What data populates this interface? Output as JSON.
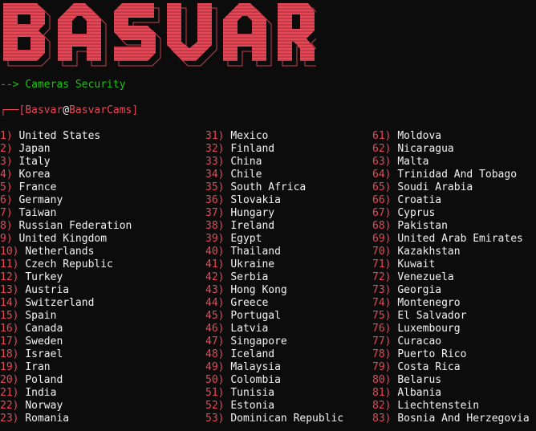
{
  "banner": {
    "text": "BASVAR",
    "color": "#e74856"
  },
  "subtitle": "--> Cameras Security",
  "prompt": {
    "prefix": "┌──[",
    "user": "Basvar",
    "at": "@",
    "host": "BasvarCams",
    "suffix": "]"
  },
  "colors": {
    "number": "#e74856",
    "text": "#f2f2f2",
    "accent": "#16c60c",
    "background": "#0c0c0c"
  },
  "countries": [
    {
      "num": "1)",
      "name": "United States"
    },
    {
      "num": "2)",
      "name": "Japan"
    },
    {
      "num": "3)",
      "name": "Italy"
    },
    {
      "num": "4)",
      "name": "Korea"
    },
    {
      "num": "5)",
      "name": "France"
    },
    {
      "num": "6)",
      "name": "Germany"
    },
    {
      "num": "7)",
      "name": "Taiwan"
    },
    {
      "num": "8)",
      "name": "Russian Federation"
    },
    {
      "num": "9)",
      "name": "United Kingdom"
    },
    {
      "num": "10)",
      "name": "Netherlands"
    },
    {
      "num": "11)",
      "name": "Czech Republic"
    },
    {
      "num": "12)",
      "name": "Turkey"
    },
    {
      "num": "13)",
      "name": "Austria"
    },
    {
      "num": "14)",
      "name": "Switzerland"
    },
    {
      "num": "15)",
      "name": "Spain"
    },
    {
      "num": "16)",
      "name": "Canada"
    },
    {
      "num": "17)",
      "name": "Sweden"
    },
    {
      "num": "18)",
      "name": "Israel"
    },
    {
      "num": "19)",
      "name": "Iran"
    },
    {
      "num": "20)",
      "name": "Poland"
    },
    {
      "num": "21)",
      "name": "India"
    },
    {
      "num": "22)",
      "name": "Norway"
    },
    {
      "num": "23)",
      "name": "Romania"
    },
    {
      "num": "31)",
      "name": "Mexico"
    },
    {
      "num": "32)",
      "name": "Finland"
    },
    {
      "num": "33)",
      "name": "China"
    },
    {
      "num": "34)",
      "name": "Chile"
    },
    {
      "num": "35)",
      "name": "South Africa"
    },
    {
      "num": "36)",
      "name": "Slovakia"
    },
    {
      "num": "37)",
      "name": "Hungary"
    },
    {
      "num": "38)",
      "name": "Ireland"
    },
    {
      "num": "39)",
      "name": "Egypt"
    },
    {
      "num": "40)",
      "name": "Thailand"
    },
    {
      "num": "41)",
      "name": "Ukraine"
    },
    {
      "num": "42)",
      "name": "Serbia"
    },
    {
      "num": "43)",
      "name": "Hong Kong"
    },
    {
      "num": "44)",
      "name": "Greece"
    },
    {
      "num": "45)",
      "name": "Portugal"
    },
    {
      "num": "46)",
      "name": "Latvia"
    },
    {
      "num": "47)",
      "name": "Singapore"
    },
    {
      "num": "48)",
      "name": "Iceland"
    },
    {
      "num": "49)",
      "name": "Malaysia"
    },
    {
      "num": "50)",
      "name": "Colombia"
    },
    {
      "num": "51)",
      "name": "Tunisia"
    },
    {
      "num": "52)",
      "name": "Estonia"
    },
    {
      "num": "53)",
      "name": "Dominican Republic"
    },
    {
      "num": "61)",
      "name": "Moldova"
    },
    {
      "num": "62)",
      "name": "Nicaragua"
    },
    {
      "num": "63)",
      "name": "Malta"
    },
    {
      "num": "64)",
      "name": "Trinidad And Tobago"
    },
    {
      "num": "65)",
      "name": "Soudi Arabia"
    },
    {
      "num": "66)",
      "name": "Croatia"
    },
    {
      "num": "67)",
      "name": "Cyprus"
    },
    {
      "num": "68)",
      "name": "Pakistan"
    },
    {
      "num": "69)",
      "name": "United Arab Emirates"
    },
    {
      "num": "70)",
      "name": "Kazakhstan"
    },
    {
      "num": "71)",
      "name": "Kuwait"
    },
    {
      "num": "72)",
      "name": "Venezuela"
    },
    {
      "num": "73)",
      "name": "Georgia"
    },
    {
      "num": "74)",
      "name": "Montenegro"
    },
    {
      "num": "75)",
      "name": "El Salvador"
    },
    {
      "num": "76)",
      "name": "Luxembourg"
    },
    {
      "num": "77)",
      "name": "Curacao"
    },
    {
      "num": "78)",
      "name": "Puerto Rico"
    },
    {
      "num": "79)",
      "name": "Costa Rica"
    },
    {
      "num": "80)",
      "name": "Belarus"
    },
    {
      "num": "81)",
      "name": "Albania"
    },
    {
      "num": "82)",
      "name": "Liechtenstein"
    },
    {
      "num": "83)",
      "name": "Bosnia And Herzegovia"
    }
  ]
}
